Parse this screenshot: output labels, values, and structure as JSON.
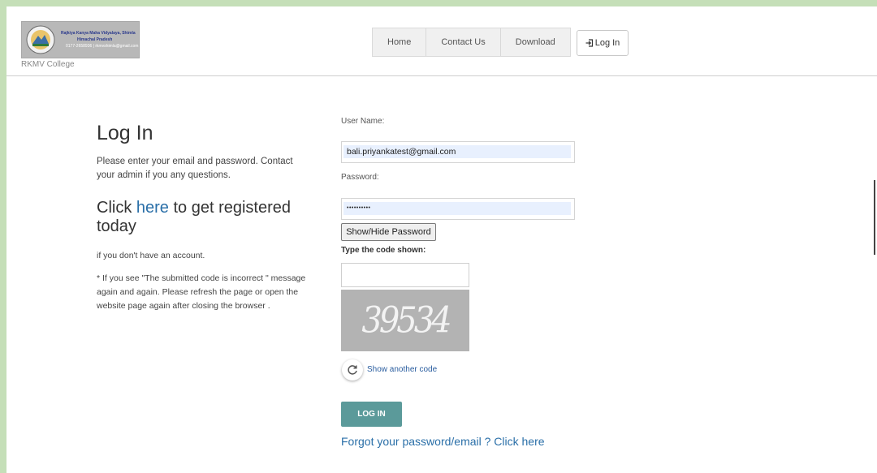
{
  "header": {
    "logo_lines": [
      "Rajkiya Kanya Maha Vidyalaya, Shimla",
      "Himachal Pradesh",
      "0177-2658936 | rkmvshimla@gmail.com"
    ],
    "college_name": "RKMV College",
    "nav": [
      "Home",
      "Contact Us",
      "Download"
    ],
    "login_label": "Log In"
  },
  "left": {
    "title": "Log In",
    "intro": "Please enter your email and password. Contact your admin if you any questions.",
    "register_prefix": "Click ",
    "register_link": "here",
    "register_suffix": " to get registered today",
    "no_account": "if you don't have an account.",
    "note": "* If you see \"The submitted code is incorrect \" message again and again. Please refresh the page or open the website page again after closing the browser ."
  },
  "form": {
    "username_label": "User Name:",
    "username_value": "bali.priyankatest@gmail.com",
    "password_label": "Password:",
    "password_value": "••••••••••",
    "show_hide_label": "Show/Hide Password",
    "code_label": "Type the code shown:",
    "code_value": "",
    "captcha_text": "39534",
    "another_code_label": "Show another code",
    "submit_label": "LOG IN",
    "forgot_label": "Forgot your password/email ? Click here"
  },
  "colors": {
    "page_background": "#c5dfb8",
    "submit_button": "#5b9a9a",
    "link": "#2a6fa8",
    "autofill": "#e8f0fe"
  }
}
